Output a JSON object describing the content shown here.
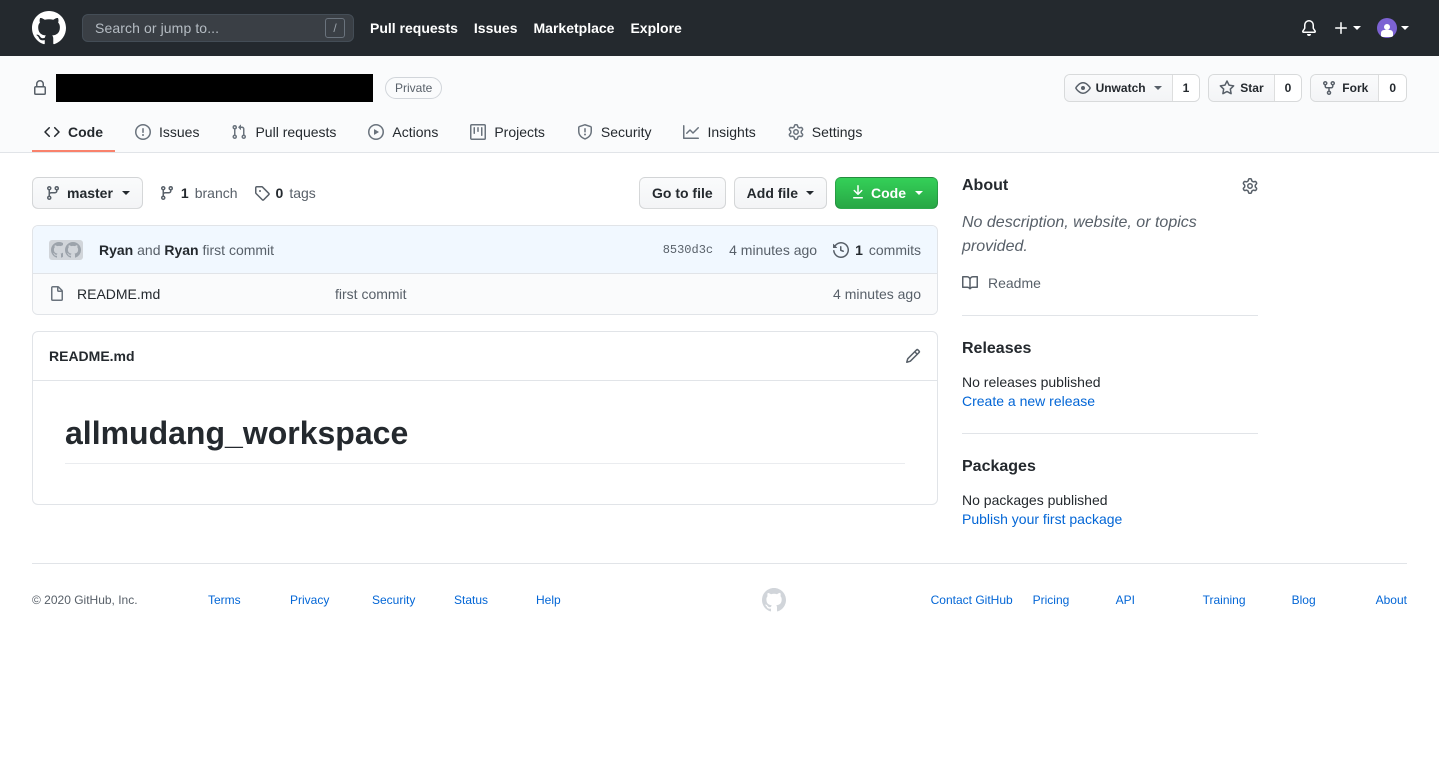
{
  "header": {
    "logo_icon": "github-mark-icon",
    "search": {
      "placeholder": "Search or jump to...",
      "value": "",
      "shortcut": "/"
    },
    "nav": [
      {
        "label": "Pull requests"
      },
      {
        "label": "Issues"
      },
      {
        "label": "Marketplace"
      },
      {
        "label": "Explore"
      }
    ],
    "notifications_icon": "bell-icon",
    "create_new_icon": "plus-icon",
    "account_icon": "avatar-icon"
  },
  "repo": {
    "lock_icon": "lock-icon",
    "name": "",
    "name_redacted": true,
    "visibility": "Private",
    "actions": {
      "watch": {
        "label": "Unwatch",
        "count": "1",
        "icon": "eye-icon"
      },
      "star": {
        "label": "Star",
        "count": "0",
        "icon": "star-icon"
      },
      "fork": {
        "label": "Fork",
        "count": "0",
        "icon": "repo-forked-icon"
      }
    },
    "tabs": [
      {
        "label": "Code",
        "icon": "code-icon",
        "active": true
      },
      {
        "label": "Issues",
        "icon": "issue-opened-icon",
        "active": false
      },
      {
        "label": "Pull requests",
        "icon": "git-pull-request-icon",
        "active": false
      },
      {
        "label": "Actions",
        "icon": "play-icon",
        "active": false
      },
      {
        "label": "Projects",
        "icon": "project-icon",
        "active": false
      },
      {
        "label": "Security",
        "icon": "shield-icon",
        "active": false
      },
      {
        "label": "Insights",
        "icon": "graph-icon",
        "active": false
      },
      {
        "label": "Settings",
        "icon": "gear-icon",
        "active": false
      }
    ]
  },
  "code_bar": {
    "branch": {
      "label": "master",
      "icon": "git-branch-icon"
    },
    "branches": {
      "count": "1",
      "label": "branch",
      "icon": "git-branch-icon"
    },
    "tags": {
      "count": "0",
      "label": "tags",
      "icon": "tag-icon"
    },
    "go_to_file": "Go to file",
    "add_file": "Add file",
    "code_button": "Code",
    "code_button_icon": "download-icon"
  },
  "latest_commit": {
    "author": "Ryan",
    "connector": "and",
    "coauthor": "Ryan",
    "message": "first commit",
    "sha": "8530d3c",
    "time": "4 minutes ago",
    "commits_count": "1",
    "commits_label": "commits",
    "history_icon": "history-icon"
  },
  "files": [
    {
      "name": "README.md",
      "icon": "file-icon",
      "commit_message": "first commit",
      "time": "4 minutes ago"
    }
  ],
  "readme": {
    "title": "README.md",
    "edit_icon": "pencil-icon",
    "heading": "allmudang_workspace"
  },
  "sidebar": {
    "about": {
      "title": "About",
      "settings_icon": "gear-icon",
      "description": "No description, website, or topics provided.",
      "readme_link": "Readme",
      "readme_icon": "book-icon"
    },
    "releases": {
      "title": "Releases",
      "empty": "No releases published",
      "action": "Create a new release"
    },
    "packages": {
      "title": "Packages",
      "empty": "No packages published",
      "action": "Publish your first package"
    }
  },
  "footer": {
    "copyright": "© 2020 GitHub, Inc.",
    "left_links": [
      {
        "label": "Terms"
      },
      {
        "label": "Privacy"
      },
      {
        "label": "Security"
      },
      {
        "label": "Status"
      },
      {
        "label": "Help"
      }
    ],
    "mark_icon": "github-mark-icon",
    "right_links": [
      {
        "label": "Contact GitHub"
      },
      {
        "label": "Pricing"
      },
      {
        "label": "API"
      },
      {
        "label": "Training"
      },
      {
        "label": "Blog"
      },
      {
        "label": "About"
      }
    ]
  },
  "colors": {
    "header_bg": "#24292e",
    "accent_green": "#28a745",
    "link_blue": "#0366d6",
    "active_tab": "#f9826c",
    "commit_row_bg": "#f1f8ff",
    "avatar_purple": "#7c62d3"
  }
}
